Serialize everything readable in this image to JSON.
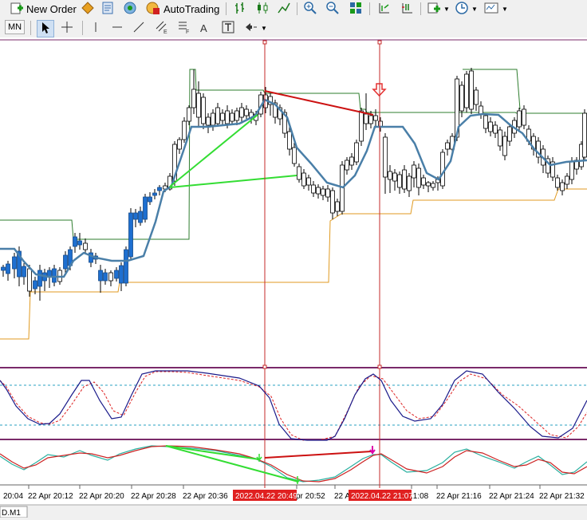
{
  "toolbar1": {
    "new_order_label": "New Order",
    "autotrading_label": "AutoTrading"
  },
  "toolbar2": {
    "timeframe_label": "MN",
    "text_tool_label": "A"
  },
  "chart": {
    "symbol_label": "D.M1",
    "time_axis_labels": [
      "20:04",
      "22 Apr 20:12",
      "22 Apr 20:20",
      "22 Apr 20:28",
      "22 Apr 20:36",
      "pr 20:52",
      "22 A",
      ":1:08",
      "22 Apr 21:16",
      "22 Apr 21:24",
      "22 Apr 21:32"
    ],
    "marker_label_1": "2022.04.22 20:49",
    "marker_label_2": "2022.04.22 21:07"
  },
  "colors": {
    "candle_bull": "#1e6fd0",
    "candle_bear": "#ffffff",
    "ma_line": "#4a7fa8",
    "upper_band": "#2e7d2e",
    "lower_band": "#e09a20",
    "divergence_green": "#33dd33",
    "divergence_red": "#cc1111",
    "vline": "#c62828",
    "stoch_main": "#1a1a8a",
    "stoch_signal": "#dd2222"
  }
}
